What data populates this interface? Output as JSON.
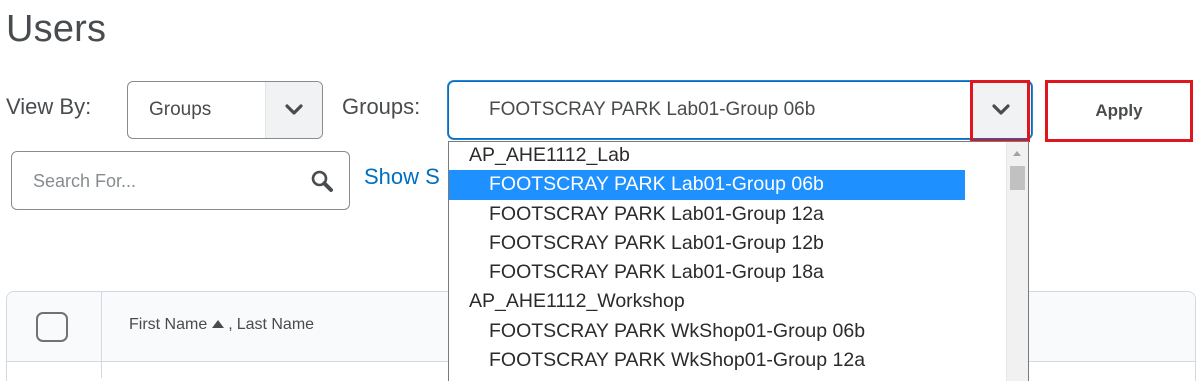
{
  "page": {
    "title": "Users"
  },
  "view_by": {
    "label": "View By:",
    "selected": "Groups",
    "chevron_icon": "chevron-down-icon"
  },
  "groups": {
    "label": "Groups:",
    "selected": "FOOTSCRAY PARK Lab01-Group 06b",
    "chevron_icon": "chevron-down-icon"
  },
  "apply_button": {
    "label": "Apply"
  },
  "search": {
    "placeholder": "Search For...",
    "icon": "search-icon"
  },
  "show_search_options": {
    "label": "Show S"
  },
  "table": {
    "header": {
      "first_name": "First Name",
      "separator": ",",
      "last_name": "Last Name",
      "sort_icon": "sort-ascending-icon"
    }
  },
  "dropdown": {
    "groups": [
      {
        "label": "AP_AHE1112_Lab",
        "options": [
          "FOOTSCRAY PARK Lab01-Group 06b",
          "FOOTSCRAY PARK Lab01-Group 12a",
          "FOOTSCRAY PARK Lab01-Group 12b",
          "FOOTSCRAY PARK Lab01-Group 18a"
        ]
      },
      {
        "label": "AP_AHE1112_Workshop",
        "options": [
          "FOOTSCRAY PARK WkShop01-Group 06b",
          "FOOTSCRAY PARK WkShop01-Group 12a"
        ]
      }
    ],
    "selected_option": "FOOTSCRAY PARK Lab01-Group 06b"
  },
  "colors": {
    "link": "#006fbf",
    "highlight_red": "#e0161e",
    "selected_option_bg": "#1e90ff",
    "focus_border": "#006fbf"
  }
}
